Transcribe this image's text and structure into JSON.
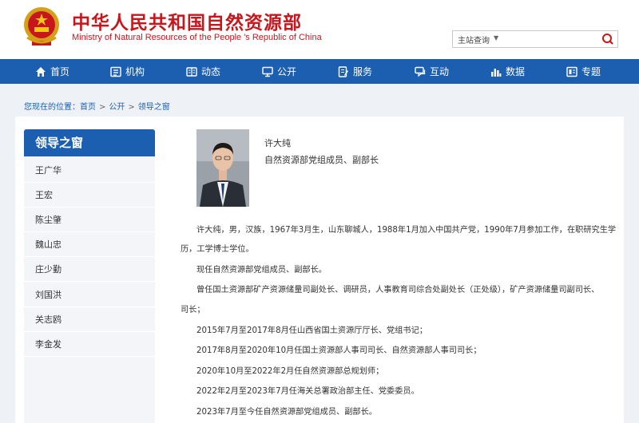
{
  "header": {
    "title_cn": "中华人民共和国自然资源部",
    "title_en": "Ministry of Natural Resources of the People 's Republic of China",
    "search_scope": "主站查询",
    "search_placeholder": ""
  },
  "nav": [
    {
      "label": "首页",
      "icon": "home-icon"
    },
    {
      "label": "机构",
      "icon": "org-icon"
    },
    {
      "label": "动态",
      "icon": "news-icon"
    },
    {
      "label": "公开",
      "icon": "monitor-icon"
    },
    {
      "label": "服务",
      "icon": "service-icon"
    },
    {
      "label": "互动",
      "icon": "chat-icon"
    },
    {
      "label": "数据",
      "icon": "bar-chart-icon"
    },
    {
      "label": "专题",
      "icon": "topic-icon"
    }
  ],
  "breadcrumb": {
    "prefix": "您现在的位置：",
    "items": [
      "首页",
      "公开",
      "领导之窗"
    ],
    "sep": ">"
  },
  "sidebar": {
    "heading": "领导之窗",
    "items": [
      "王广华",
      "王宏",
      "陈尘肇",
      "魏山忠",
      "庄少勤",
      "刘国洪",
      "关志鸥",
      "李金发"
    ]
  },
  "profile": {
    "name": "许大纯",
    "title": "自然资源部党组成员、副部长",
    "paragraphs": [
      "许大纯，男，汉族，1967年3月生，山东聊城人，1988年1月加入中国共产党，1990年7月参加工作，在职研究生学",
      "历，工学博士学位。",
      "现任自然资源部党组成员、副部长。",
      "曾任国土资源部矿产资源储量司副处长、调研员，人事教育司综合处副处长（正处级），矿产资源储量司副司长、",
      "司长；",
      "2015年7月至2017年8月任山西省国土资源厅厅长、党组书记；",
      "2017年8月至2020年10月任国土资源部人事司司长、自然资源部人事司司长；",
      "2020年10月至2022年2月任自然资源部总规划师；",
      "2022年2月至2023年7月任海关总署政治部主任、党委委员。",
      "2023年7月至今任自然资源部党组成员、副部长。"
    ]
  },
  "colors": {
    "brand_red": "#c8161d",
    "nav_blue": "#1c5fb0"
  }
}
